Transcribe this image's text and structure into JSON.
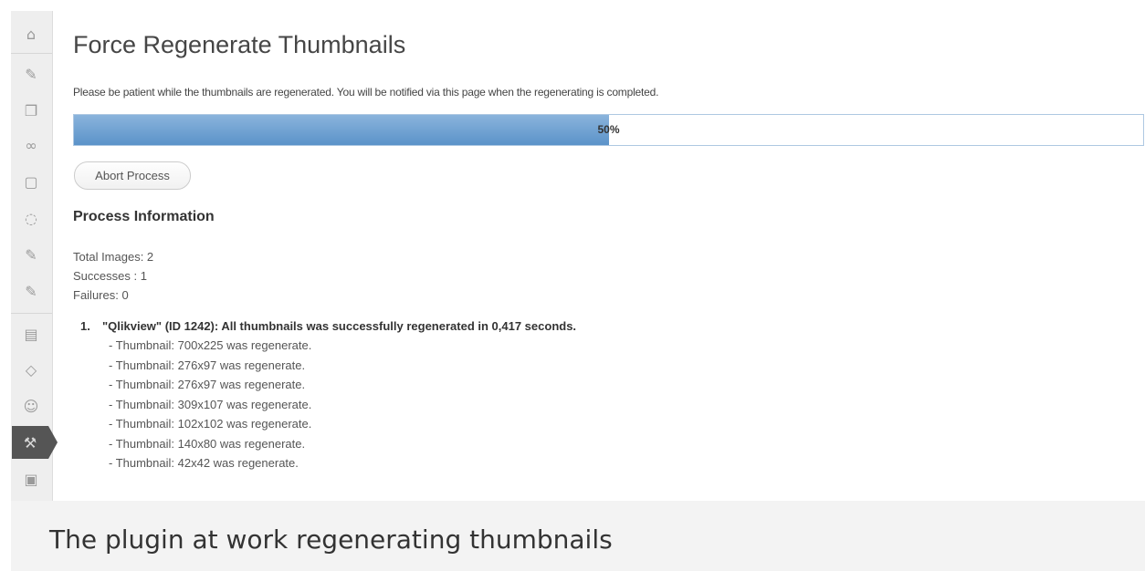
{
  "page": {
    "title": "Force Regenerate Thumbnails",
    "notice": "Please be patient while the thumbnails are regenerated. You will be notified via this page when the regenerating is completed.",
    "progress": {
      "percent": 50,
      "label": "50%"
    },
    "abort_button": "Abort Process",
    "process_info": {
      "title": "Process Information",
      "total_images": "Total Images: 2",
      "successes": "Successes : 1",
      "failures": "Failures: 0"
    },
    "results": [
      {
        "number": "1.",
        "summary": "\"Qlikview\" (ID 1242): All thumbnails was successfully regenerated in 0,417 seconds.",
        "lines": [
          "- Thumbnail: 700x225 was regenerate.",
          "- Thumbnail: 276x97 was regenerate.",
          "- Thumbnail: 276x97 was regenerate.",
          "- Thumbnail: 309x107 was regenerate.",
          "- Thumbnail: 102x102 was regenerate.",
          "- Thumbnail: 140x80 was regenerate.",
          "- Thumbnail: 42x42 was regenerate."
        ]
      }
    ]
  },
  "sidebar": {
    "icons": [
      "dashboard-icon",
      "posts-pin-icon",
      "media-icon",
      "links-icon",
      "pages-icon",
      "comments-icon",
      "pin-icon",
      "pin-icon",
      "appearance-icon",
      "plugins-icon",
      "users-icon",
      "tools-icon",
      "settings-icon"
    ]
  },
  "caption": "The plugin at work regenerating thumbnails",
  "colors": {
    "progress_fill": "#6a9fd3",
    "sidebar_active": "#555555"
  }
}
